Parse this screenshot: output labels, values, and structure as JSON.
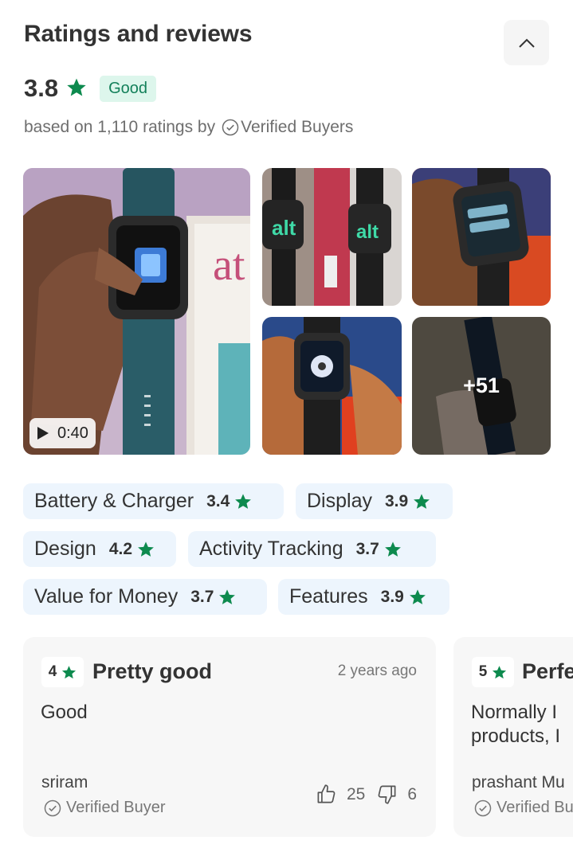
{
  "section": {
    "title": "Ratings and reviews"
  },
  "summary": {
    "rating": "3.8",
    "badge": "Good",
    "based_on": "based on 1,110 ratings by",
    "verified_label": "Verified Buyers"
  },
  "media": {
    "video_duration": "0:40",
    "more_count": "+51"
  },
  "aspects": [
    {
      "label": "Battery & Charger",
      "score": "3.4"
    },
    {
      "label": "Display",
      "score": "3.9"
    },
    {
      "label": "Design",
      "score": "4.2"
    },
    {
      "label": "Activity Tracking",
      "score": "3.7"
    },
    {
      "label": "Value for Money",
      "score": "3.7"
    },
    {
      "label": "Features",
      "score": "3.9"
    }
  ],
  "reviews": [
    {
      "rating": "4",
      "title": "Pretty good",
      "date": "2 years ago",
      "body": [
        "Good"
      ],
      "author": "sriram",
      "verified": "Verified Buyer",
      "likes": "25",
      "dislikes": "6"
    },
    {
      "rating": "5",
      "title": "Perfe",
      "body": [
        "Normally I",
        "products, I"
      ],
      "author": "prashant Mu",
      "verified": "Verified Bu"
    }
  ],
  "colors": {
    "star_green": "#0d8a4e",
    "badge_bg": "#ddf6ec",
    "chip_bg": "#edf5fd",
    "card_bg": "#f7f7f7"
  }
}
